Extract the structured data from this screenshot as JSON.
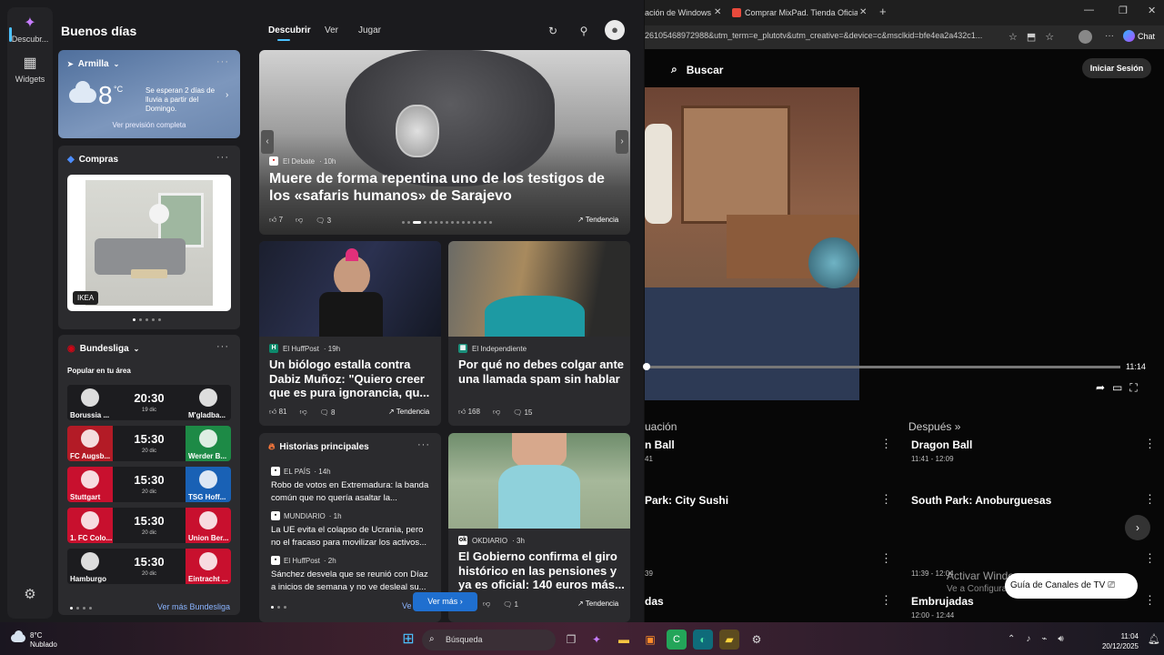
{
  "panel": {
    "greeting": "Buenos días",
    "tabs": [
      "Descubrir",
      "Ver",
      "Jugar"
    ],
    "rail": [
      {
        "label": "Descubr..."
      },
      {
        "label": "Widgets"
      }
    ]
  },
  "weather": {
    "location": "Armilla",
    "temp": "8",
    "unit": "°C",
    "forecast": "Se esperan 2 días de lluvia a partir del Domingo.",
    "link": "Ver previsión completa"
  },
  "shopping": {
    "title": "Compras",
    "brand": "IKEA"
  },
  "bundesliga": {
    "title": "Bundesliga",
    "subtitle": "Popular en tu área",
    "more_link": "Ver más Bundesliga",
    "matches": [
      {
        "home": "Borussia ...",
        "away": "M'gladba...",
        "time": "20:30",
        "date": "19 dic",
        "home_color": "#1c1c1f",
        "away_color": "#1c1c1f"
      },
      {
        "home": "FC Augsb...",
        "away": "Werder B...",
        "time": "15:30",
        "date": "20 dic",
        "home_color": "#b31b26",
        "away_color": "#1d8a46"
      },
      {
        "home": "Stuttgart",
        "away": "TSG Hoff...",
        "time": "15:30",
        "date": "20 dic",
        "home_color": "#c8102e",
        "away_color": "#1961b5"
      },
      {
        "home": "1. FC Colo...",
        "away": "Union Ber...",
        "time": "15:30",
        "date": "20 dic",
        "home_color": "#c8102e",
        "away_color": "#c8102e"
      },
      {
        "home": "Hamburgo",
        "away": "Eintracht ...",
        "time": "15:30",
        "date": "20 dic",
        "home_color": "#1c1c1f",
        "away_color": "#c8102e"
      }
    ]
  },
  "hero": {
    "source": "El Debate",
    "age": "10h",
    "title": "Muere de forma repentina uno de los testigos de los «safaris humanos» de Sarajevo",
    "likes": "7",
    "comments": "3",
    "trend": "Tendencia"
  },
  "news": [
    {
      "source": "El HuffPost",
      "age": "19h",
      "title": "Un biólogo estalla contra Dabiz Muñoz: \"Quiero creer que es pura ignorancia, qu...",
      "likes": "81",
      "comments": "8",
      "trend": "Tendencia"
    },
    {
      "source": "El Independiente",
      "age": "",
      "title": "Por qué no debes colgar ante una llamada spam sin hablar",
      "likes": "168",
      "comments": "15"
    },
    {
      "source": "OKDIARIO",
      "age": "3h",
      "title": "El Gobierno confirma el giro histórico en las pensiones y ya es oficial: 140 euros más...",
      "comments": "1",
      "trend": "Tendencia"
    }
  ],
  "top_stories": {
    "title": "Historias principales",
    "items": [
      {
        "source": "EL PAÍS",
        "age": "14h",
        "text": "Robo de votos en Extremadura: la banda común que no quería asaltar la..."
      },
      {
        "source": "MUNDIARIO",
        "age": "1h",
        "text": "La UE evita el colapso de Ucrania, pero no el fracaso para movilizar los activos..."
      },
      {
        "source": "El HuffPost",
        "age": "2h",
        "text": "Sánchez desvela que se reunió con Díaz a inicios de semana y no ve desleal su..."
      }
    ],
    "ver": "Ve",
    "see_more": "Ver más"
  },
  "browser": {
    "tab1": "ación de Windows",
    "tab2": "Comprar MixPad. Tienda Oficial de",
    "address": "26105468972988&utm_term=e_plutotv&utm_creative=&device=c&msclkid=bfe4ea2a432c1...",
    "chat": "Chat"
  },
  "tv": {
    "search": "Buscar",
    "login": "Iniciar Sesión",
    "time": "11:14",
    "col_now": "uación",
    "col_next": "Después",
    "rows": [
      {
        "now": "n Ball",
        "now_time": "41",
        "next": "Dragon Ball",
        "next_time": "11:41 - 12:09"
      },
      {
        "now": "Park: City Sushi",
        "now_time": "",
        "next": "South Park: Anoburguesas",
        "next_time": ""
      },
      {
        "now": "",
        "now_time": "39",
        "next": "",
        "next_time": "11:39 - 12:04"
      },
      {
        "now": "das",
        "now_time": "",
        "next": "Embrujadas",
        "next_time": "12:00 - 12:44"
      }
    ],
    "activate": "Activar Windows",
    "activate_sub": "Ve a Configura",
    "guide_btn": "Guía de Canales de TV"
  },
  "taskbar": {
    "weather_temp": "8°C",
    "weather_desc": "Nublado",
    "search": "Búsqueda",
    "time": "11:04",
    "date": "20/12/2025"
  }
}
